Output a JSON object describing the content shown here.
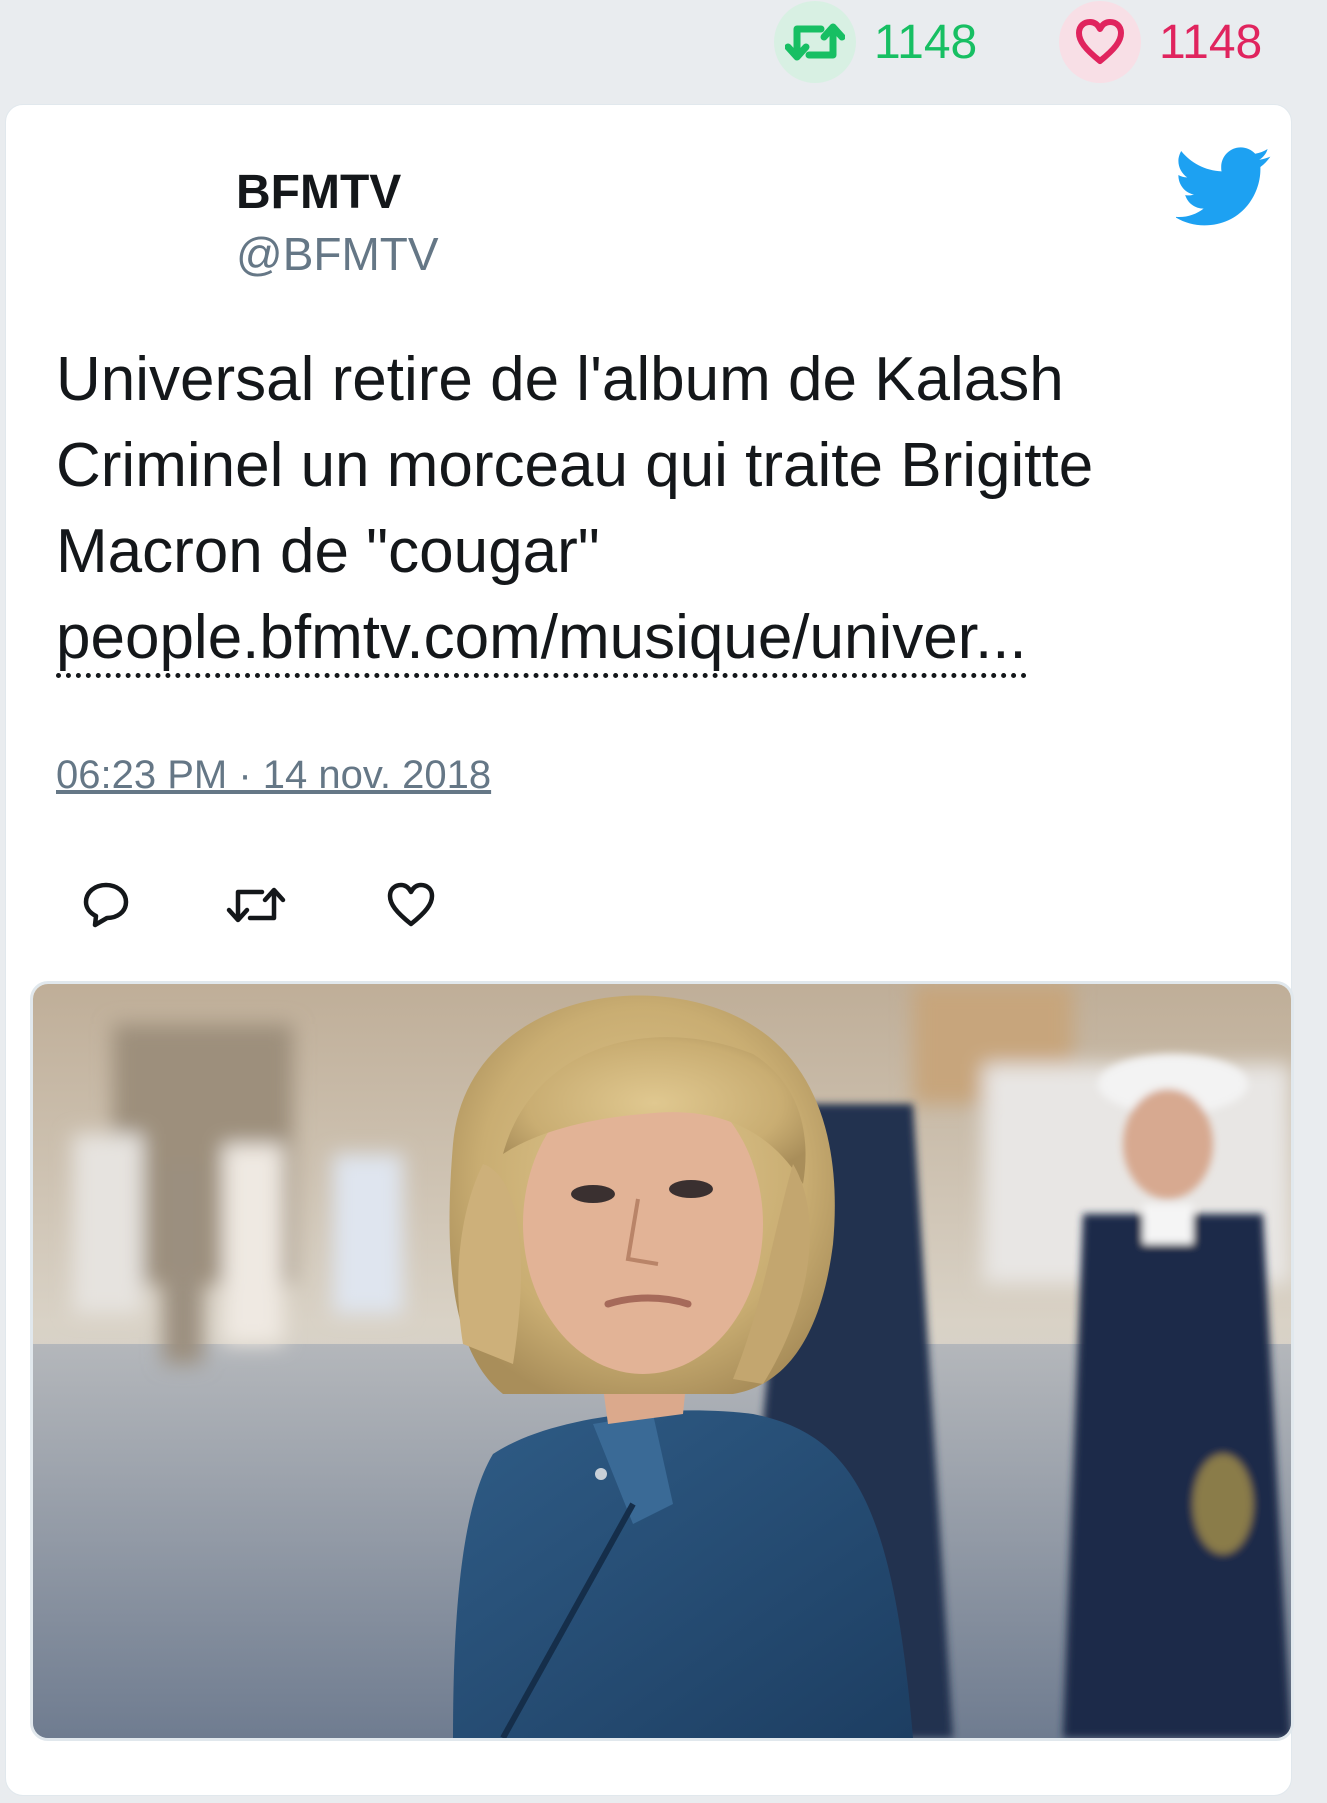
{
  "stats": {
    "retweets": "1148",
    "likes": "1148",
    "retweet_color": "#17bf63",
    "like_color": "#e0245e"
  },
  "tweet": {
    "author_name": "BFMTV",
    "author_handle": "@BFMTV",
    "text": "Universal retire de l'album de Kalash Criminel un morceau qui traite Brigitte Macron de \"cougar\"",
    "link": "people.bfmtv.com/musique/univer...",
    "timestamp": "06:23 PM · 14 nov. 2018"
  },
  "icons": {
    "brand": "twitter-bird-icon",
    "actions": [
      "reply-icon",
      "retweet-icon",
      "like-icon"
    ]
  },
  "colors": {
    "twitter_blue": "#1da1f2",
    "text": "#14171a",
    "muted": "#657786"
  }
}
